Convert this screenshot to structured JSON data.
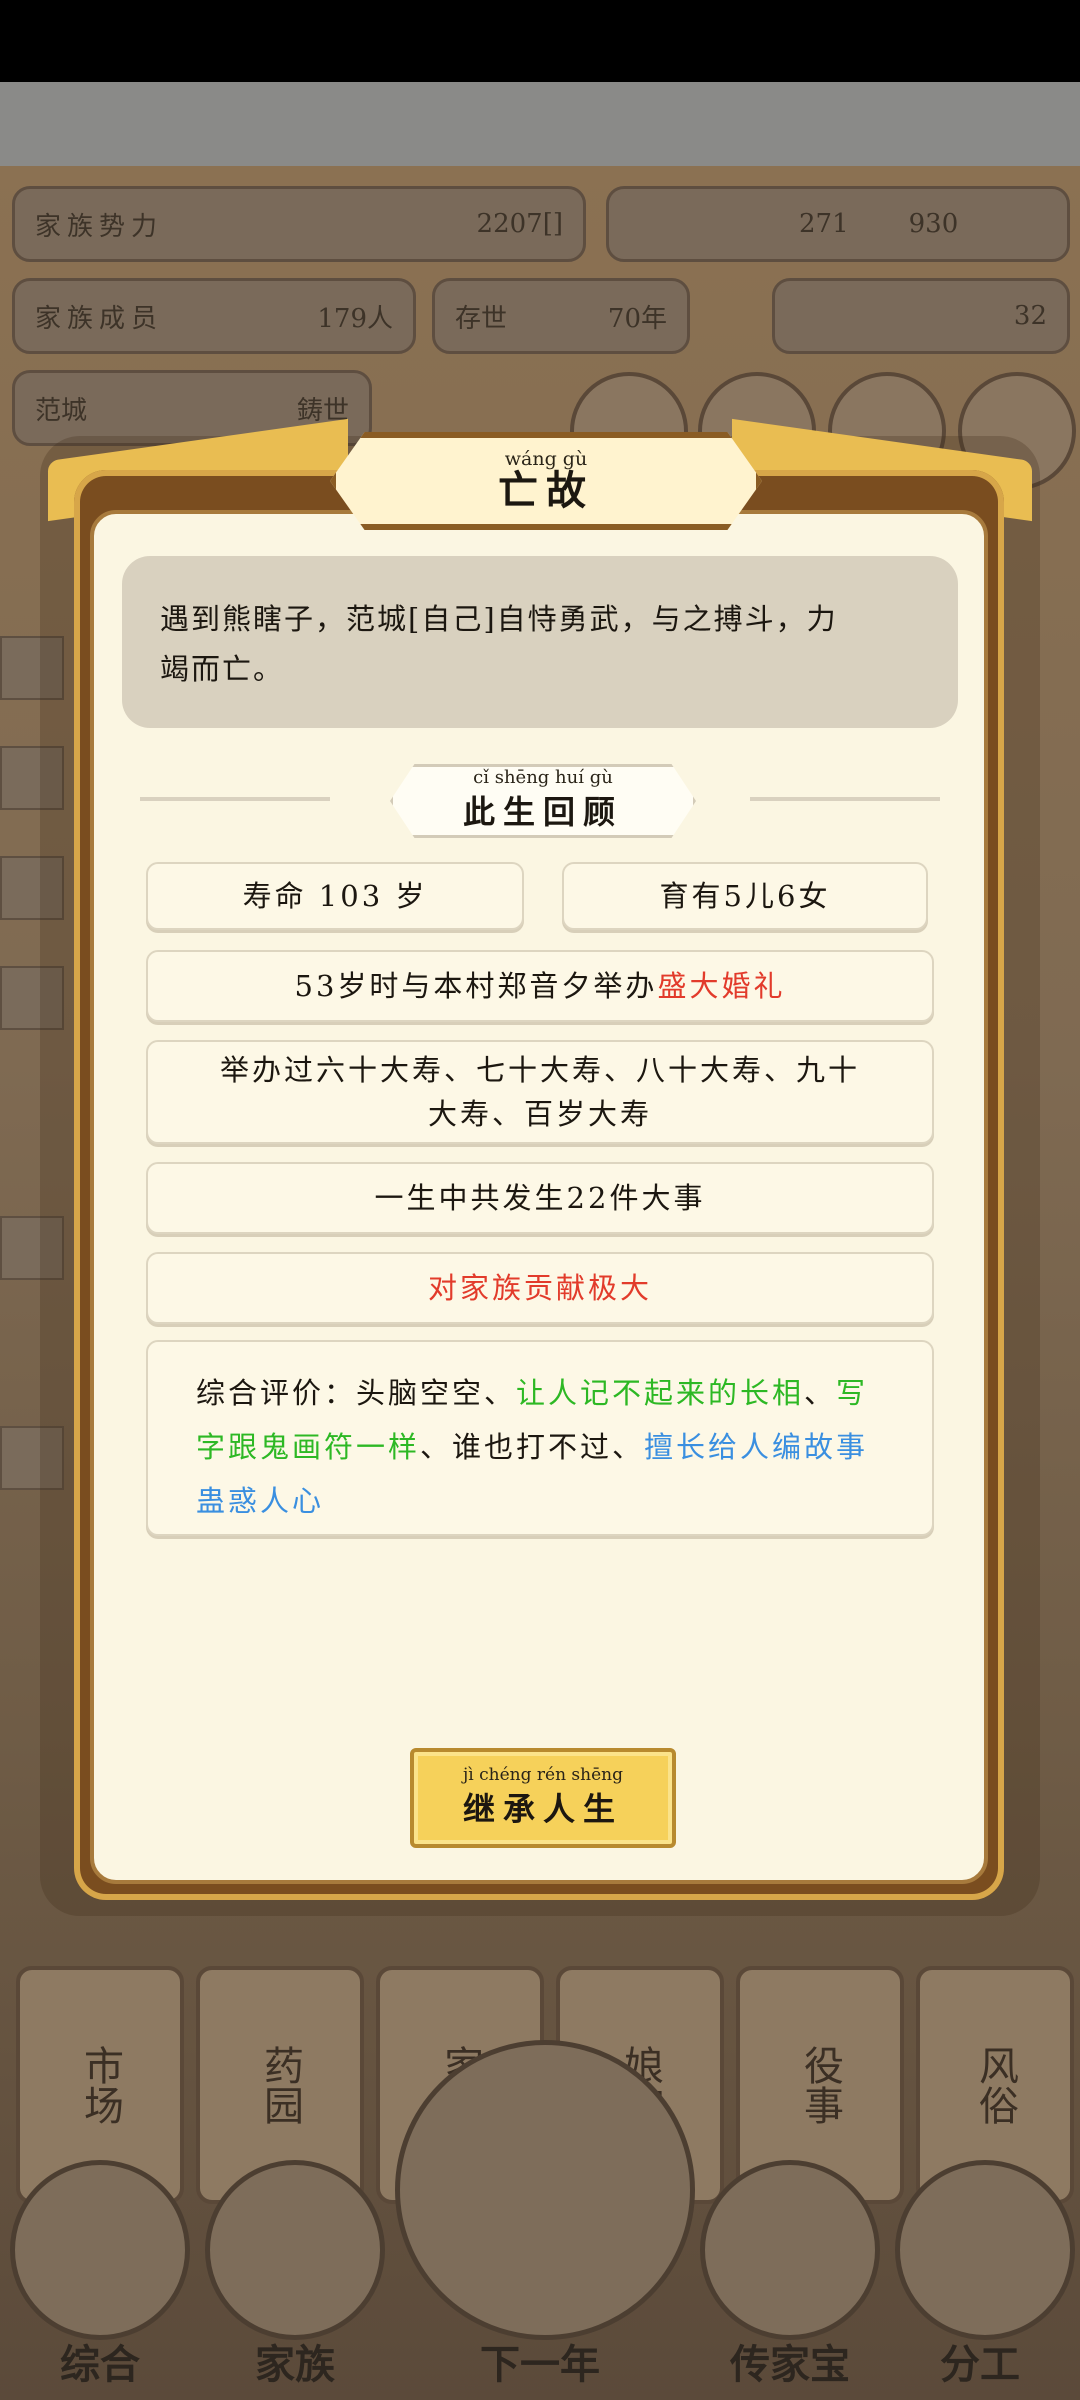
{
  "background": {
    "clan_power_label": "家族势力",
    "clan_power_value": "2207[",
    "clan_power_suffix": "]",
    "silver": "271",
    "copper": "930",
    "members_label": "家族成员",
    "members_value": "179人",
    "alive_label": "存世",
    "alive_value": "70年",
    "gold": "32",
    "city_label": "范城",
    "city_value": "鋳世",
    "cards": [
      "市场",
      "药园",
      "家风",
      "娘馆",
      "役事",
      "风俗"
    ],
    "nav": [
      "综合",
      "家族",
      "下一年",
      "传家宝",
      "分工"
    ]
  },
  "modal": {
    "title_pinyin": "wáng gù",
    "title": "亡故",
    "death_line1": "遇到熊瞎子，范城[自己]自恃勇武，与之搏斗，力",
    "death_line2": "竭而亡。",
    "review_pinyin": "cǐ shēng huí gù",
    "review_title": "此生回顾",
    "lifespan": "寿命 103 岁",
    "children": "育有5儿6女",
    "marriage_prefix": "53岁时与本村郑音夕举办",
    "marriage_highlight": "盛大婚礼",
    "birthdays_line1": "举办过六十大寿、七十大寿、八十大寿、九十",
    "birthdays_line2": "大寿、百岁大寿",
    "events": "一生中共发生22件大事",
    "contribution": "对家族贡献极大",
    "eval_prefix": "综合评价：头脑空空、",
    "eval_green1": "让人记不起来的长相",
    "eval_sep1": "、",
    "eval_green2": "写字跟鬼画符一样",
    "eval_mid": "、谁也打不过、",
    "eval_blue1": "擅长给人编",
    "eval_blue2": "故事蛊惑人心",
    "button_pinyin": "jì chéng rén shēng",
    "button": "继承人生"
  },
  "colors": {
    "red": "#e23b2b",
    "green": "#2db824",
    "blue": "#3a8fe0",
    "panel": "#fbf6e2",
    "frame": "#7a4d1f",
    "gold": "#e9bd52"
  }
}
